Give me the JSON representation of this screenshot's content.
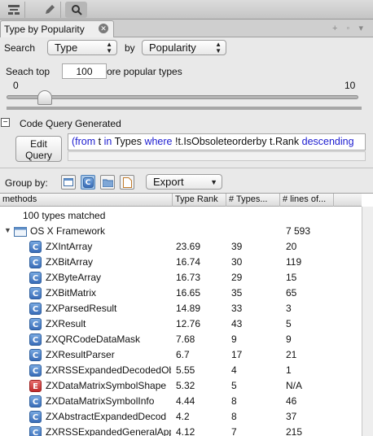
{
  "toolbar": {
    "icons": [
      "hierarchy-icon",
      "pencil-icon",
      "search-icon"
    ]
  },
  "tab": {
    "title": "Type by Popularity",
    "close_glyph": "✕",
    "tools_glyphs": "+ ◦ ▾"
  },
  "search": {
    "label": "Search",
    "type_value": "Type",
    "by_label": "by",
    "by_value": "Popularity"
  },
  "top": {
    "label": "Seach top",
    "value": "100",
    "suffix": "ore popular types"
  },
  "slider": {
    "min": "0",
    "max": "10",
    "value_fraction": 0.11
  },
  "code_query": {
    "toggle": "−",
    "title": "Code Query Generated",
    "edit_label_1": "Edit",
    "edit_label_2": "Query",
    "q1": "(from",
    "q2": "t",
    "q3": "in",
    "q4": "Types",
    "q5": "where",
    "q6": "!t.IsObsoleteorderby t.Rank",
    "q7": "descending"
  },
  "group_by": {
    "label": "Group by:",
    "export_label": "Export",
    "icons": [
      "window-icon",
      "class-icon",
      "folder-icon",
      "document-icon"
    ]
  },
  "grid": {
    "columns": [
      "methods",
      "Type Rank",
      "# Types...",
      "# lines of..."
    ],
    "matched": "100 types matched",
    "framework": {
      "name": "OS X Framework",
      "lines": "7 593"
    },
    "rows": [
      {
        "kind": "class",
        "icon": "C",
        "name": "ZXIntArray",
        "rank": "23.69",
        "types": "39",
        "lines": "20"
      },
      {
        "kind": "class",
        "icon": "C",
        "name": "ZXBitArray",
        "rank": "16.74",
        "types": "30",
        "lines": "119"
      },
      {
        "kind": "class",
        "icon": "C",
        "name": "ZXByteArray",
        "rank": "16.73",
        "types": "29",
        "lines": "15"
      },
      {
        "kind": "class",
        "icon": "C",
        "name": "ZXBitMatrix",
        "rank": "16.65",
        "types": "35",
        "lines": "65"
      },
      {
        "kind": "class",
        "icon": "C",
        "name": "ZXParsedResult",
        "rank": "14.89",
        "types": "33",
        "lines": "3"
      },
      {
        "kind": "class",
        "icon": "C",
        "name": "ZXResult",
        "rank": "12.76",
        "types": "43",
        "lines": "5"
      },
      {
        "kind": "class",
        "icon": "C",
        "name": "ZXQRCodeDataMask",
        "rank": "7.68",
        "types": "9",
        "lines": "9"
      },
      {
        "kind": "class",
        "icon": "C",
        "name": "ZXResultParser",
        "rank": "6.7",
        "types": "17",
        "lines": "21"
      },
      {
        "kind": "class",
        "icon": "C",
        "name": "ZXRSSExpandedDecodedOb",
        "rank": "5.55",
        "types": "4",
        "lines": "1"
      },
      {
        "kind": "enum",
        "icon": "E",
        "name": "ZXDataMatrixSymbolShape",
        "rank": "5.32",
        "types": "5",
        "lines": "N/A"
      },
      {
        "kind": "class",
        "icon": "C",
        "name": "ZXDataMatrixSymbolInfo",
        "rank": "4.44",
        "types": "8",
        "lines": "46"
      },
      {
        "kind": "class",
        "icon": "C",
        "name": "ZXAbstractExpandedDecod",
        "rank": "4.2",
        "types": "8",
        "lines": "37"
      },
      {
        "kind": "class",
        "icon": "C",
        "name": "ZXRSSExpandedGeneralApp",
        "rank": "4.12",
        "types": "7",
        "lines": "215"
      }
    ]
  }
}
